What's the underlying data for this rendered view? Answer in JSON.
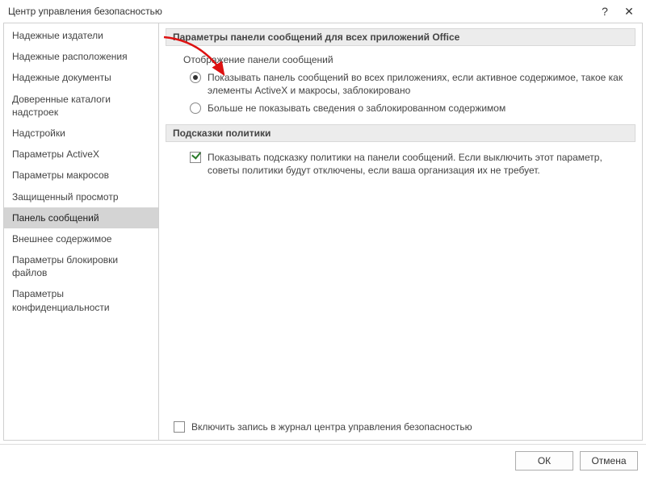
{
  "window": {
    "title": "Центр управления безопасностью",
    "help_icon": "?",
    "close_icon": "✕"
  },
  "sidebar": {
    "items": [
      {
        "label": "Надежные издатели"
      },
      {
        "label": "Надежные расположения"
      },
      {
        "label": "Надежные документы"
      },
      {
        "label": "Доверенные каталоги надстроек"
      },
      {
        "label": "Надстройки"
      },
      {
        "label": "Параметры ActiveX"
      },
      {
        "label": "Параметры макросов"
      },
      {
        "label": "Защищенный просмотр"
      },
      {
        "label": "Панель сообщений",
        "selected": true
      },
      {
        "label": "Внешнее содержимое"
      },
      {
        "label": "Параметры блокировки файлов"
      },
      {
        "label": "Параметры конфиденциальности"
      }
    ]
  },
  "content": {
    "section1": {
      "title": "Параметры панели сообщений для всех приложений Office",
      "subtitle": "Отображение панели сообщений",
      "options": [
        {
          "label": "Показывать панель сообщений во всех приложениях, если активное содержимое, такое как элементы ActiveX и макросы, заблокировано",
          "checked": true
        },
        {
          "label": "Больше не показывать сведения о заблокированном содержимом",
          "checked": false
        }
      ]
    },
    "section2": {
      "title": "Подсказки политики",
      "options": [
        {
          "label": "Показывать подсказку политики на панели сообщений. Если выключить этот параметр, советы политики будут отключены, если ваша организация их не требует.",
          "checked": true
        }
      ]
    },
    "logging": {
      "label": "Включить запись в журнал центра управления безопасностью",
      "checked": false
    }
  },
  "footer": {
    "ok": "ОК",
    "cancel": "Отмена"
  }
}
